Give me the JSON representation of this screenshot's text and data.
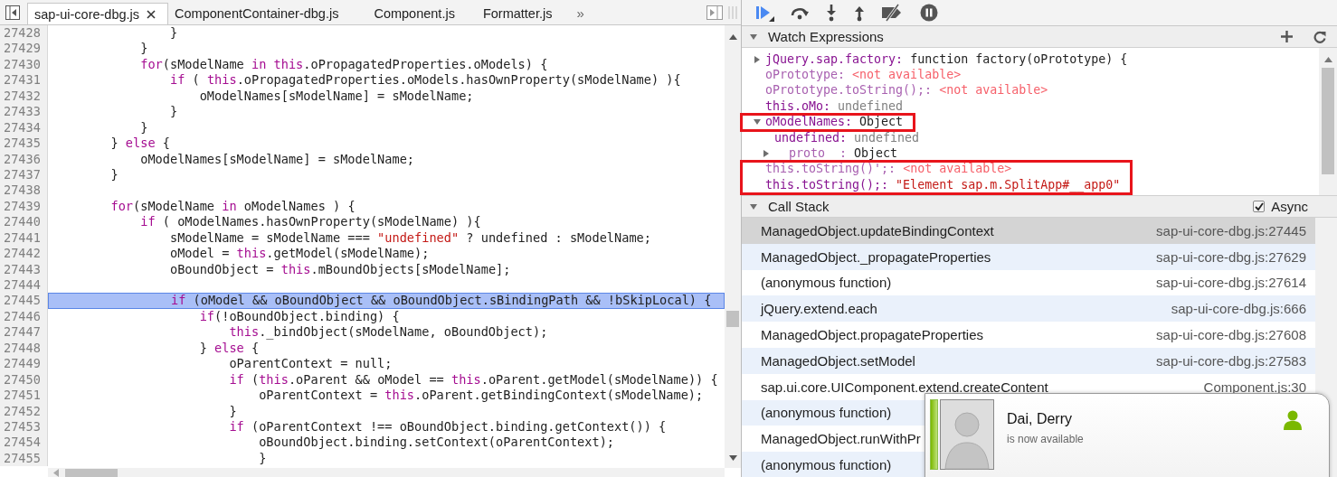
{
  "editor": {
    "tabs": [
      {
        "label": "sap-ui-core-dbg.js",
        "selected": true,
        "closable": true
      },
      {
        "label": "ComponentContainer-dbg.js",
        "selected": false,
        "closable": false
      },
      {
        "label": "Component.js",
        "selected": false,
        "closable": false
      },
      {
        "label": "Formatter.js",
        "selected": false,
        "closable": false
      }
    ],
    "overflow_label": "»",
    "lines": [
      {
        "number": "27428",
        "current": false,
        "code": [
          {
            "text": "                }",
            "kind": "plain"
          }
        ]
      },
      {
        "number": "27429",
        "current": false,
        "code": [
          {
            "text": "            }",
            "kind": "plain"
          }
        ]
      },
      {
        "number": "27430",
        "current": false,
        "code": [
          {
            "text": "            for",
            "kind": "keyword"
          },
          {
            "text": "(sModelName ",
            "kind": "plain"
          },
          {
            "text": "in this",
            "kind": "keyword"
          },
          {
            "text": ".oPropagatedProperties.oModels) {",
            "kind": "plain"
          }
        ]
      },
      {
        "number": "27431",
        "current": false,
        "code": [
          {
            "text": "                if",
            "kind": "keyword"
          },
          {
            "text": " ( ",
            "kind": "plain"
          },
          {
            "text": "this",
            "kind": "keyword"
          },
          {
            "text": ".oPropagatedProperties.oModels.hasOwnProperty(sModelName) ){",
            "kind": "plain"
          }
        ]
      },
      {
        "number": "27432",
        "current": false,
        "code": [
          {
            "text": "                    oModelNames[sModelName] = sModelName;",
            "kind": "plain"
          }
        ]
      },
      {
        "number": "27433",
        "current": false,
        "code": [
          {
            "text": "                }",
            "kind": "plain"
          }
        ]
      },
      {
        "number": "27434",
        "current": false,
        "code": [
          {
            "text": "            }",
            "kind": "plain"
          }
        ]
      },
      {
        "number": "27435",
        "current": false,
        "code": [
          {
            "text": "        } ",
            "kind": "plain"
          },
          {
            "text": "else",
            "kind": "keyword"
          },
          {
            "text": " {",
            "kind": "plain"
          }
        ]
      },
      {
        "number": "27436",
        "current": false,
        "code": [
          {
            "text": "            oModelNames[sModelName] = sModelName;",
            "kind": "plain"
          }
        ]
      },
      {
        "number": "27437",
        "current": false,
        "code": [
          {
            "text": "        }",
            "kind": "plain"
          }
        ]
      },
      {
        "number": "27438",
        "current": false
      },
      {
        "number": "27439",
        "current": false,
        "code": [
          {
            "text": "        for",
            "kind": "keyword"
          },
          {
            "text": "(sModelName ",
            "kind": "plain"
          },
          {
            "text": "in",
            "kind": "keyword"
          },
          {
            "text": " oModelNames ) {",
            "kind": "plain"
          }
        ]
      },
      {
        "number": "27440",
        "current": false,
        "code": [
          {
            "text": "            if",
            "kind": "keyword"
          },
          {
            "text": " ( oModelNames.hasOwnProperty(sModelName) ){",
            "kind": "plain"
          }
        ]
      },
      {
        "number": "27441",
        "current": false,
        "code": [
          {
            "text": "                sModelName = sModelName === ",
            "kind": "plain"
          },
          {
            "text": "\"undefined\"",
            "kind": "string"
          },
          {
            "text": " ? undefined : sModelName;",
            "kind": "plain"
          }
        ]
      },
      {
        "number": "27442",
        "current": false,
        "code": [
          {
            "text": "                oModel = ",
            "kind": "plain"
          },
          {
            "text": "this",
            "kind": "keyword"
          },
          {
            "text": ".getModel(sModelName);",
            "kind": "plain"
          }
        ]
      },
      {
        "number": "27443",
        "current": false,
        "code": [
          {
            "text": "                oBoundObject = ",
            "kind": "plain"
          },
          {
            "text": "this",
            "kind": "keyword"
          },
          {
            "text": ".mBoundObjects[sModelName];",
            "kind": "plain"
          }
        ]
      },
      {
        "number": "27444",
        "current": false
      },
      {
        "number": "27445",
        "current": true,
        "code": [
          {
            "text": "                if",
            "kind": "keyword"
          },
          {
            "text": " (oModel && oBoundObject && oBoundObject.sBindingPath && !bSkipLocal) {",
            "kind": "plain"
          }
        ]
      },
      {
        "number": "27446",
        "current": false,
        "code": [
          {
            "text": "                    if",
            "kind": "keyword"
          },
          {
            "text": "(!oBoundObject.binding) {",
            "kind": "plain"
          }
        ]
      },
      {
        "number": "27447",
        "current": false,
        "code": [
          {
            "text": "                        this",
            "kind": "keyword"
          },
          {
            "text": "._bindObject(sModelName, oBoundObject);",
            "kind": "plain"
          }
        ]
      },
      {
        "number": "27448",
        "current": false,
        "code": [
          {
            "text": "                    } ",
            "kind": "plain"
          },
          {
            "text": "else",
            "kind": "keyword"
          },
          {
            "text": " {",
            "kind": "plain"
          }
        ]
      },
      {
        "number": "27449",
        "current": false,
        "code": [
          {
            "text": "                        oParentContext = null;",
            "kind": "plain"
          }
        ]
      },
      {
        "number": "27450",
        "current": false,
        "code": [
          {
            "text": "                        if",
            "kind": "keyword"
          },
          {
            "text": " (",
            "kind": "plain"
          },
          {
            "text": "this",
            "kind": "keyword"
          },
          {
            "text": ".oParent && oModel == ",
            "kind": "plain"
          },
          {
            "text": "this",
            "kind": "keyword"
          },
          {
            "text": ".oParent.getModel(sModelName)) {",
            "kind": "plain"
          }
        ]
      },
      {
        "number": "27451",
        "current": false,
        "code": [
          {
            "text": "                            oParentContext = ",
            "kind": "plain"
          },
          {
            "text": "this",
            "kind": "keyword"
          },
          {
            "text": ".oParent.getBindingContext(sModelName);",
            "kind": "plain"
          }
        ]
      },
      {
        "number": "27452",
        "current": false,
        "code": [
          {
            "text": "                        }",
            "kind": "plain"
          }
        ]
      },
      {
        "number": "27453",
        "current": false,
        "code": [
          {
            "text": "                        if",
            "kind": "keyword"
          },
          {
            "text": " (oParentContext !== oBoundObject.binding.getContext()) {",
            "kind": "plain"
          }
        ]
      },
      {
        "number": "27454",
        "current": false,
        "code": [
          {
            "text": "                            oBoundObject.binding.setContext(oParentContext);",
            "kind": "plain"
          }
        ]
      },
      {
        "number": "27455",
        "current": false,
        "code": [
          {
            "text": "                            }",
            "kind": "plain"
          }
        ]
      }
    ]
  },
  "watch": {
    "title": "Watch Expressions",
    "expanded": true,
    "items": [
      {
        "name": "jQuery.sap.factory:",
        "value": "function factory(oPrototype) {",
        "kind": "function",
        "available": true,
        "expandable": true,
        "expanded": false,
        "boxed": false
      },
      {
        "name": "oPrototype:",
        "value": "<not available>",
        "kind": "unavailable",
        "available": false,
        "expandable": false,
        "boxed": false
      },
      {
        "name": "oPrototype.toString();:",
        "value": "<not available>",
        "kind": "unavailable",
        "available": false,
        "expandable": false,
        "boxed": false
      },
      {
        "name": "this.oMo:",
        "value": "undefined",
        "kind": "undefined",
        "available": true,
        "expandable": false,
        "boxed": false
      },
      {
        "name": "oModelNames:",
        "value": "Object",
        "kind": "object",
        "available": true,
        "expandable": true,
        "expanded": true,
        "boxed": true,
        "children": [
          {
            "name": "undefined:",
            "value": "undefined",
            "kind": "undefined",
            "available": true,
            "expandable": false
          },
          {
            "name": "proto  :",
            "value": "Object",
            "kind": "object",
            "available": false,
            "expandable": true,
            "expanded": false
          }
        ]
      },
      {
        "name": "this.toString()';:",
        "value": "<not available>",
        "kind": "unavailable",
        "available": false,
        "expandable": false,
        "boxed": true
      },
      {
        "name": "this.toString();:",
        "value": "\"Element sap.m.SplitApp#__app0\"",
        "kind": "string",
        "available": true,
        "expandable": false,
        "boxed": true
      }
    ]
  },
  "call_stack": {
    "title": "Call Stack",
    "expanded": true,
    "async": {
      "label": "Async",
      "checked": true
    },
    "frames": [
      {
        "function": "ManagedObject.updateBindingContext",
        "location": "sap-ui-core-dbg.js:27445",
        "selected": true
      },
      {
        "function": "ManagedObject._propagateProperties",
        "location": "sap-ui-core-dbg.js:27629",
        "selected": false
      },
      {
        "function": "(anonymous function)",
        "location": "sap-ui-core-dbg.js:27614",
        "selected": false
      },
      {
        "function": "jQuery.extend.each",
        "location": "sap-ui-core-dbg.js:666",
        "selected": false
      },
      {
        "function": "ManagedObject.propagateProperties",
        "location": "sap-ui-core-dbg.js:27608",
        "selected": false
      },
      {
        "function": "ManagedObject.setModel",
        "location": "sap-ui-core-dbg.js:27583",
        "selected": false
      },
      {
        "function": "sap.ui.core.UIComponent.extend.createContent",
        "location": "Component.js:30",
        "selected": false
      },
      {
        "function": "(anonymous function)",
        "selected": false
      },
      {
        "function": "ManagedObject.runWithPr",
        "selected": false
      },
      {
        "function": "(anonymous function)",
        "selected": false
      }
    ]
  },
  "notification": {
    "name": "Dai, Derry",
    "message": "is now available",
    "color": "#7ab800"
  }
}
